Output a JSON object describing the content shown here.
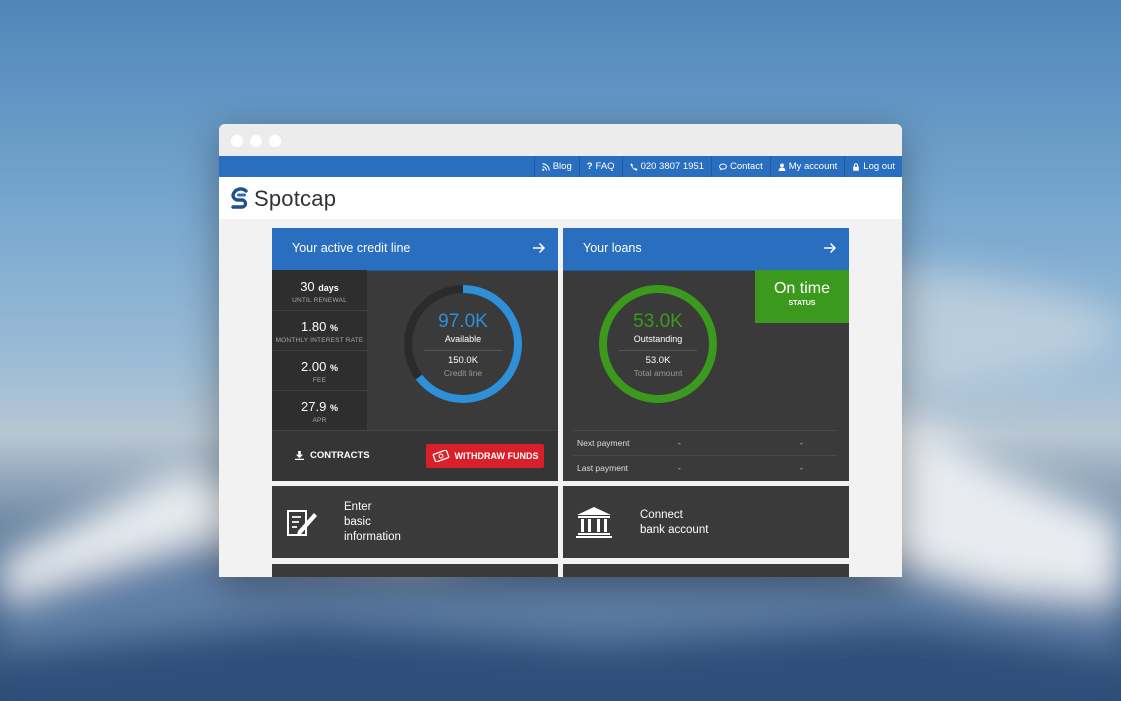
{
  "topnav": {
    "items": [
      {
        "label": "Blog",
        "icon": "rss-icon"
      },
      {
        "label": "FAQ",
        "icon": "question-icon"
      },
      {
        "label": "020 3807 1951",
        "icon": "phone-icon"
      },
      {
        "label": "Contact",
        "icon": "chat-icon"
      },
      {
        "label": "My account",
        "icon": "user-icon"
      },
      {
        "label": "Log out",
        "icon": "lock-icon"
      }
    ]
  },
  "header": {
    "logo_text": "Spotcap"
  },
  "credit_panel": {
    "title": "Your active credit line",
    "stats": [
      {
        "value": "30",
        "unit": "days",
        "label": "UNTIL RENEWAL"
      },
      {
        "value": "1.80",
        "unit": "%",
        "label": "MONTHLY INTEREST RATE"
      },
      {
        "value": "2.00",
        "unit": "%",
        "label": "FEE"
      },
      {
        "value": "27.9",
        "unit": "%",
        "label": "APR"
      }
    ],
    "gauge": {
      "main_value": "97.0K",
      "main_label": "Available",
      "secondary_value": "150.0K",
      "secondary_label": "Credit line",
      "fill_fraction": 0.647,
      "color": "#2f8fd8"
    },
    "contracts_label": "CONTRACTS",
    "withdraw_label": "WITHDRAW FUNDS"
  },
  "loans_panel": {
    "title": "Your loans",
    "gauge": {
      "main_value": "53.0K",
      "main_label": "Outstanding",
      "secondary_value": "53.0K",
      "secondary_label": "Total amount",
      "fill_fraction": 1.0,
      "color": "#3b9a1d"
    },
    "status": {
      "value": "On time",
      "label": "STATUS"
    },
    "payments": [
      {
        "label": "Next payment",
        "col1": "-",
        "col2": "-"
      },
      {
        "label": "Last payment",
        "col1": "-",
        "col2": "-"
      }
    ]
  },
  "cards": [
    {
      "text_lines": [
        "Enter",
        "basic",
        "information"
      ],
      "icon": "form-edit-icon"
    },
    {
      "text_lines": [
        "Connect",
        "bank account"
      ],
      "icon": "bank-icon"
    }
  ],
  "colors": {
    "brand_blue": "#2a6ebf",
    "panel_dark": "#3a3a3a",
    "danger_red": "#d9202a",
    "success_green": "#3b9a1d"
  }
}
